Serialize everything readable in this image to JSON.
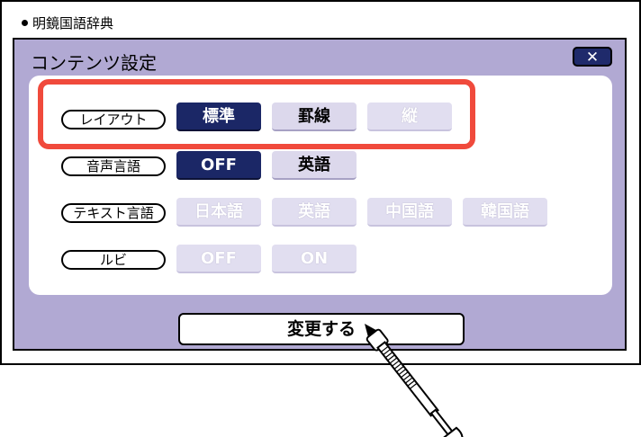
{
  "app": {
    "title": "明鏡国語辞典"
  },
  "dialog": {
    "title": "コンテンツ設定",
    "close_label": "✕",
    "rows": [
      {
        "label": "レイアウト",
        "options": [
          {
            "text": "標準",
            "state": "selected"
          },
          {
            "text": "罫線",
            "state": "available"
          },
          {
            "text": "縦",
            "state": "disabled"
          }
        ]
      },
      {
        "label": "音声言語",
        "options": [
          {
            "text": "OFF",
            "state": "selected"
          },
          {
            "text": "英語",
            "state": "available"
          }
        ]
      },
      {
        "label": "テキスト言語",
        "options": [
          {
            "text": "日本語",
            "state": "disabled"
          },
          {
            "text": "英語",
            "state": "disabled"
          },
          {
            "text": "中国語",
            "state": "disabled"
          },
          {
            "text": "韓国語",
            "state": "disabled"
          }
        ]
      },
      {
        "label": "ルビ",
        "options": [
          {
            "text": "OFF",
            "state": "disabled"
          },
          {
            "text": "ON",
            "state": "disabled"
          }
        ]
      }
    ],
    "apply_label": "変更する"
  },
  "colors": {
    "dialog_bg": "#b1a9d3",
    "selected": "#1b2766",
    "highlight": "#f04a3c"
  },
  "icons": {
    "close": "close-icon",
    "pointer": "stylus-icon"
  }
}
